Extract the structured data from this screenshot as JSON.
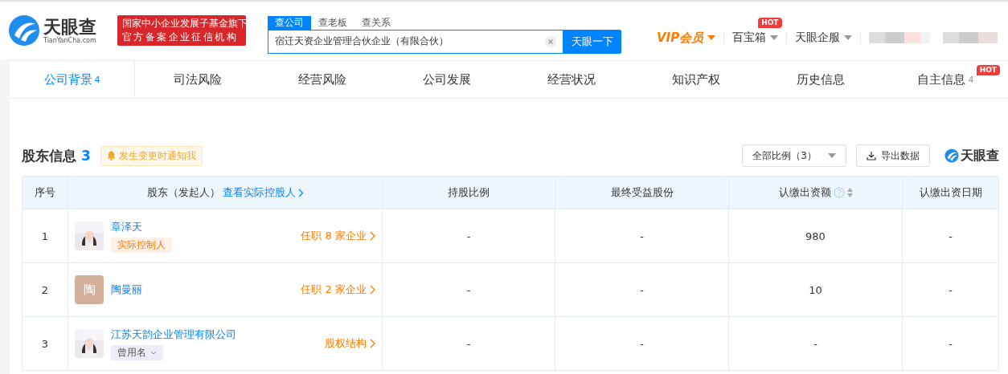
{
  "header": {
    "logo": {
      "name": "天眼查",
      "domain": "TianYanCha.com"
    },
    "banner": [
      "国家中小企业发展子基金旗下",
      "官方备案企业征信机构"
    ],
    "search": {
      "tabs": [
        {
          "label": "查公司",
          "selected": true
        },
        {
          "label": "查老板",
          "selected": false
        },
        {
          "label": "查关系",
          "selected": false
        }
      ],
      "value": "宿迁天资企业管理合伙企业（有限合伙）",
      "button": "天眼一下"
    },
    "nav": [
      {
        "label": "VIP会员",
        "kind": "vip"
      },
      {
        "label": "百宝箱",
        "kind": "menu",
        "badge": "HOT"
      },
      {
        "label": "天眼企服",
        "kind": "menu"
      }
    ]
  },
  "tabs": [
    {
      "label": "公司背景",
      "count": "4",
      "selected": true
    },
    {
      "label": "司法风险",
      "selected": false
    },
    {
      "label": "经营风险",
      "selected": false
    },
    {
      "label": "公司发展",
      "selected": false
    },
    {
      "label": "经营状况",
      "selected": false
    },
    {
      "label": "知识产权",
      "selected": false
    },
    {
      "label": "历史信息",
      "selected": false
    },
    {
      "label": "自主信息",
      "count": "4",
      "selected": false,
      "badge": "HOT"
    }
  ],
  "section": {
    "title": "股东信息",
    "count": "3",
    "notify": "发生变更时通知我",
    "filter": "全部比例（3）",
    "export": "导出数据",
    "brand": "天眼查"
  },
  "table": {
    "columns": [
      {
        "label": "序号"
      },
      {
        "label": "股东（发起人）",
        "link": "查看实际控股人"
      },
      {
        "label": "持股比例"
      },
      {
        "label": "最终受益股份"
      },
      {
        "label": "认缴出资额",
        "sortable": true
      },
      {
        "label": "认缴出资日期"
      }
    ],
    "rows": [
      {
        "index": "1",
        "name": "章泽天",
        "tag": {
          "kind": "controller",
          "label": "实际控制人"
        },
        "link": "任职 8 家企业",
        "ratio": "-",
        "benefit": "-",
        "amount": "980",
        "date": "-"
      },
      {
        "index": "2",
        "avatar": {
          "kind": "letter",
          "letter": "陶",
          "color": "#d4b09c"
        },
        "name": "陶曼丽",
        "link": "任职 2 家企业",
        "ratio": "-",
        "benefit": "-",
        "amount": "10",
        "date": "-"
      },
      {
        "index": "3",
        "name": "江苏天韵企业管理有限公司",
        "tag": {
          "kind": "alias",
          "label": "曾用名"
        },
        "link": "股权结构",
        "ratio": "-",
        "benefit": "-",
        "amount": "-",
        "date": "-"
      }
    ]
  }
}
